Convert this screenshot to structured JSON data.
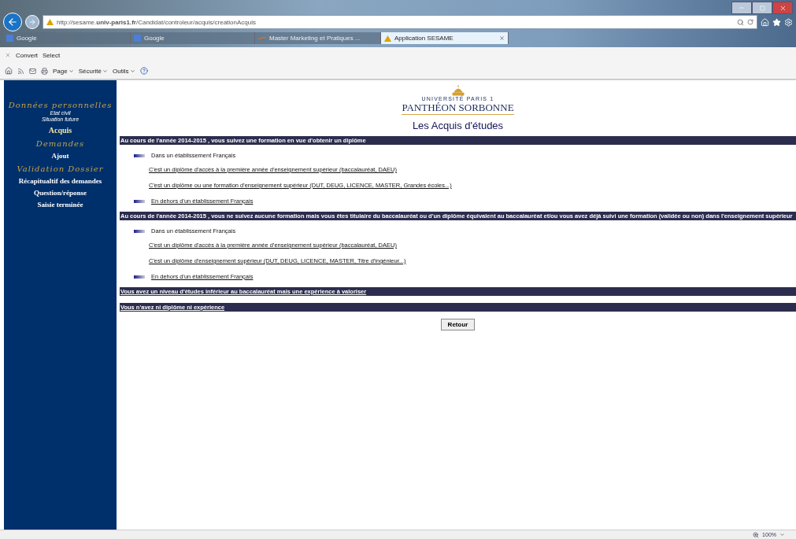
{
  "browser": {
    "address": "http://sesame.**univ-paris1.fr**/Candidat/controleur/acquis/creationAcquis",
    "tabs": [
      {
        "label": "Google",
        "kind": "google",
        "selected": false
      },
      {
        "label": "Google",
        "kind": "google",
        "selected": false
      },
      {
        "label": "Master Marketing et Pratiques ...",
        "kind": "page",
        "selected": false
      },
      {
        "label": "Application SESAME",
        "kind": "sesame",
        "selected": true
      }
    ],
    "addon_bar": [
      "Convert",
      "Select"
    ],
    "command_bar": [
      "Page",
      "Sécurité",
      "Outils"
    ],
    "zoom": "100%"
  },
  "sidebar": [
    {
      "heading": "Données personnelles",
      "items": [
        {
          "label": "Etat civil",
          "kind": "sub",
          "selected": false
        },
        {
          "label": "Situation future",
          "kind": "sub",
          "selected": false
        },
        {
          "label": "Acquis",
          "kind": "main",
          "selected": true
        }
      ]
    },
    {
      "heading": "Demandes",
      "items": [
        {
          "label": "Ajout",
          "kind": "main",
          "selected": false
        }
      ]
    },
    {
      "heading": "Validation Dossier",
      "items": [
        {
          "label": "Récapitualtif des demandes",
          "kind": "main",
          "selected": false
        },
        {
          "label": "Question/réponse",
          "kind": "main",
          "selected": false
        },
        {
          "label": "Saisie terminée",
          "kind": "main",
          "selected": false
        }
      ]
    }
  ],
  "logo": {
    "line1": "UNIVERSITÉ PARIS 1",
    "line2": "PANTHÉON SORBONNE"
  },
  "title": "Les Acquis d'études",
  "sections": [
    {
      "heading": "Au cours de l'année 2014-2015 , vous suivez une formation en vue d'obtenir un diplôme",
      "link": false,
      "items": [
        {
          "kind": "category",
          "label": "Dans un établissement Français",
          "link": false
        },
        {
          "kind": "link",
          "label": "C'est un diplôme d'accès à la première année d'enseignement supérieur (baccalauréat, DAEU)"
        },
        {
          "kind": "link",
          "label": "C'est un diplôme ou une formation d'enseignement supérieur (DUT, DEUG, LICENCE, MASTER, Grandes écoles...)"
        },
        {
          "kind": "category",
          "label": "En dehors d'un établissement Français",
          "link": true
        }
      ]
    },
    {
      "heading": "Au cours de l'année 2014-2015 , vous ne suivez aucune formation mais vous êtes titulaire du baccalauréat ou d'un diplôme équivalent au baccalauréat et/ou vous avez déjà suivi une formation (validée ou non) dans l'enseignement supérieur",
      "link": false,
      "items": [
        {
          "kind": "category",
          "label": "Dans un établissement Français",
          "link": false
        },
        {
          "kind": "link",
          "label": "C'est un diplôme d'accès à la première année d'enseignement supérieur (baccalauréat, DAEU)"
        },
        {
          "kind": "link",
          "label": "C'est un diplôme d'enseignement supérieur (DUT, DEUG, LICENCE, MASTER, Titre d'ingénieur...)"
        },
        {
          "kind": "category",
          "label": "En dehors d'un établissement Français",
          "link": true
        }
      ]
    },
    {
      "heading": "Vous avez un niveau d'études inférieur au baccalauréat mais une expérience à valoriser",
      "link": true
    },
    {
      "heading": "Vous n'avez ni diplôme ni expérience",
      "link": true
    }
  ],
  "button": "Retour"
}
